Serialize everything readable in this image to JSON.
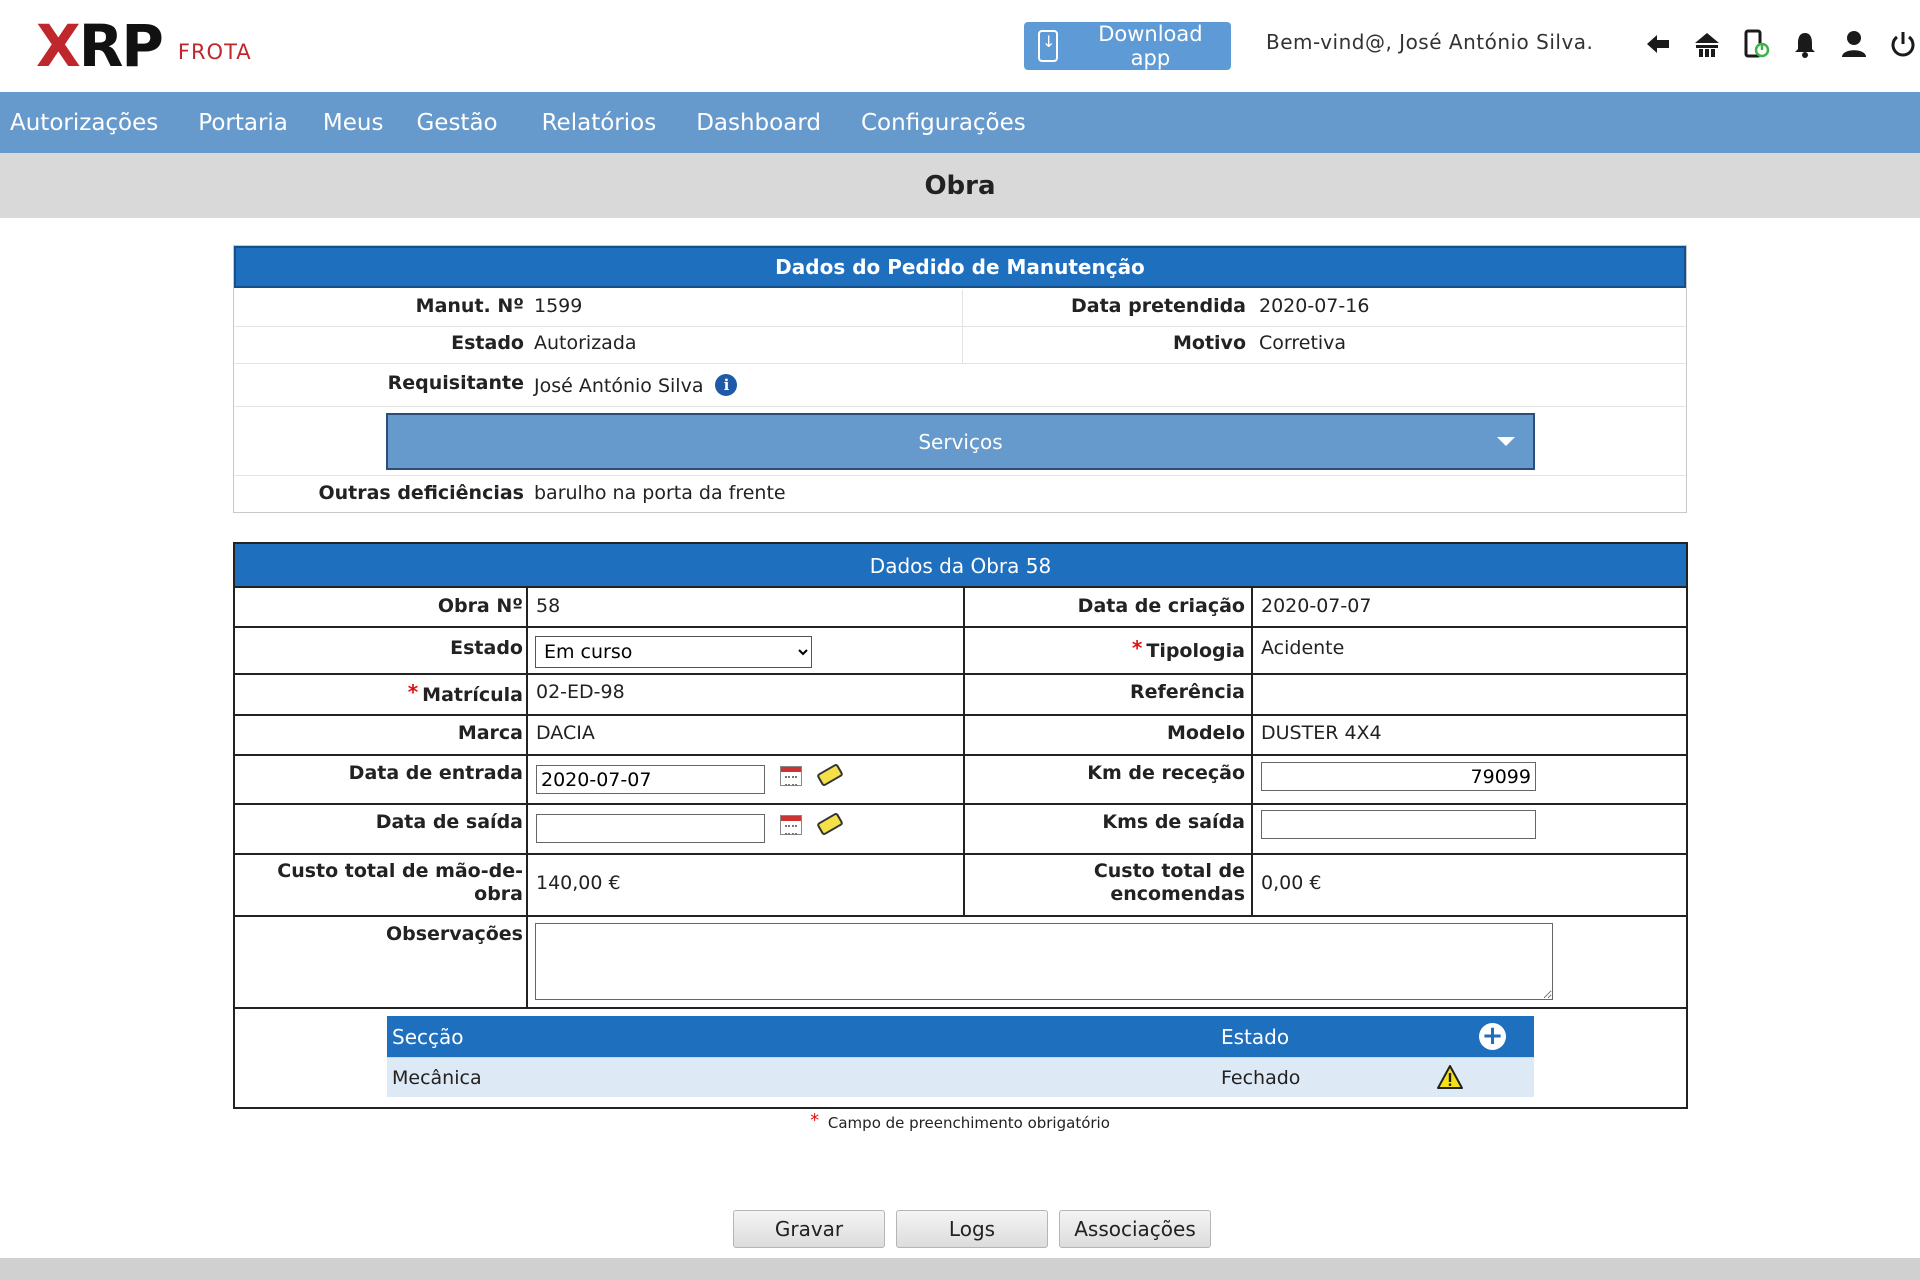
{
  "app": {
    "logo_main_x": "X",
    "logo_main_rp": "RP",
    "logo_sub": "FROTA",
    "download_label": "Download app",
    "welcome": "Bem-vind@, José António Silva."
  },
  "header_icons": [
    "back-arrow-icon",
    "home-icon",
    "mobile-power-icon",
    "bell-icon",
    "user-icon",
    "power-icon"
  ],
  "nav": [
    "Autorizações",
    "Portaria",
    "Meus",
    "Gestão",
    "Relatórios",
    "Dashboard",
    "Configurações"
  ],
  "page_title": "Obra",
  "pedido": {
    "heading": "Dados do Pedido de Manutenção",
    "manut_label": "Manut. Nº",
    "manut_value": "1599",
    "data_pretendida_label": "Data pretendida",
    "data_pretendida_value": "2020-07-16",
    "estado_label": "Estado",
    "estado_value": "Autorizada",
    "motivo_label": "Motivo",
    "motivo_value": "Corretiva",
    "requisitante_label": "Requisitante",
    "requisitante_value": "José António Silva",
    "info_glyph": "i",
    "servicos_label": "Serviços",
    "outras_label": "Outras deficiências",
    "outras_value": "barulho na porta da frente"
  },
  "obra": {
    "heading": "Dados da Obra 58",
    "obra_no_label": "Obra Nº",
    "obra_no_value": "58",
    "data_criacao_label": "Data de criação",
    "data_criacao_value": "2020-07-07",
    "estado_label": "Estado",
    "estado_selected": "Em curso",
    "tipologia_label": "Tipologia",
    "tipologia_value": "Acidente",
    "matricula_label": "Matrícula",
    "matricula_value": "02-ED-98",
    "referencia_label": "Referência",
    "referencia_value": "",
    "marca_label": "Marca",
    "marca_value": "DACIA",
    "modelo_label": "Modelo",
    "modelo_value": "DUSTER 4X4",
    "data_entrada_label": "Data de entrada",
    "data_entrada_value": "2020-07-07",
    "km_rececao_label": "Km de receção",
    "km_rececao_value": "79099",
    "data_saida_label": "Data de saída",
    "data_saida_value": "",
    "kms_saida_label": "Kms de saída",
    "kms_saida_value": "",
    "custo_mao_label_1": "Custo total de mão-de-",
    "custo_mao_label_2": "obra",
    "custo_mao_value": "140,00 €",
    "custo_enc_label_1": "Custo total de",
    "custo_enc_label_2": "encomendas",
    "custo_enc_value": "0,00 €",
    "observacoes_label": "Observações",
    "observacoes_value": ""
  },
  "seccoes": {
    "col_seccao": "Secção",
    "col_estado": "Estado",
    "add_glyph": "+",
    "rows": [
      {
        "seccao": "Mecânica",
        "estado": "Fechado",
        "status_icon": "warning-icon"
      }
    ]
  },
  "required_mark": "*",
  "required_note": "Campo de preenchimento obrigatório",
  "buttons": {
    "gravar": "Gravar",
    "logs": "Logs",
    "associacoes": "Associações"
  },
  "colors": {
    "nav_bg": "#6699cc",
    "panel_head": "#1f6fbf",
    "brand_red": "#c0272d",
    "required_red": "#e01010"
  }
}
